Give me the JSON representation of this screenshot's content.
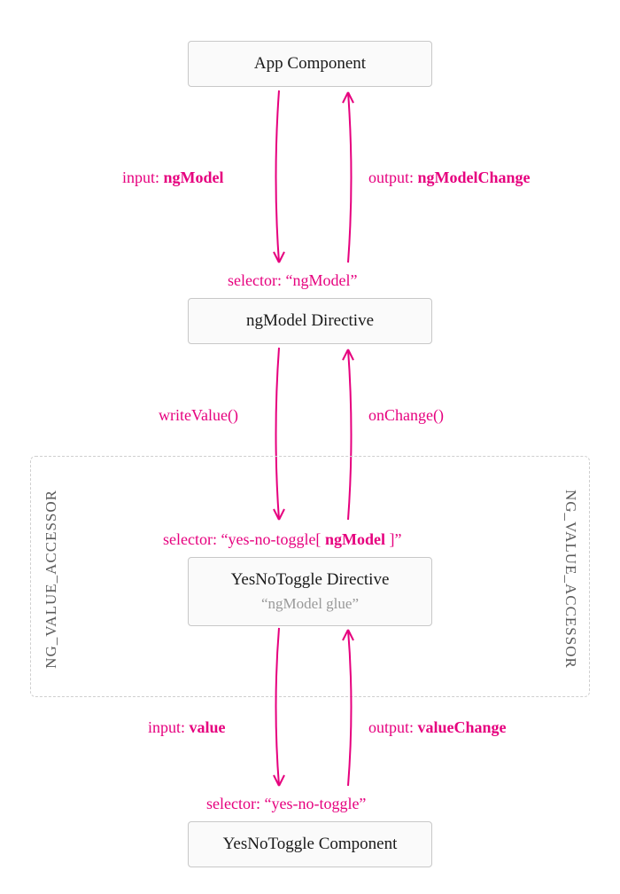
{
  "boxes": {
    "app": {
      "title": "App Component"
    },
    "ngmodel": {
      "selector": "selector: “ngModel”",
      "title": "ngModel Directive"
    },
    "toggleDir": {
      "selector_prefix": "selector: “yes-no-toggle[ ",
      "selector_bold": "ngModel",
      "selector_suffix": " ]”",
      "title": "YesNoToggle Directive",
      "subtitle": "“ngModel glue”"
    },
    "toggleCmp": {
      "selector": "selector: “yes-no-toggle”",
      "title": "YesNoToggle Component"
    }
  },
  "arrows": {
    "a1": {
      "left_prefix": "input: ",
      "left_bold": "ngModel",
      "right_prefix": "output: ",
      "right_bold": "ngModelChange"
    },
    "a2": {
      "left": "writeValue()",
      "right": "onChange()"
    },
    "a3": {
      "left_prefix": "input: ",
      "left_bold": "value",
      "right_prefix": "output: ",
      "right_bold": "valueChange"
    }
  },
  "accessor_label": "NG_VALUE_ACCESSOR",
  "colors": {
    "pink": "#e6007e"
  }
}
